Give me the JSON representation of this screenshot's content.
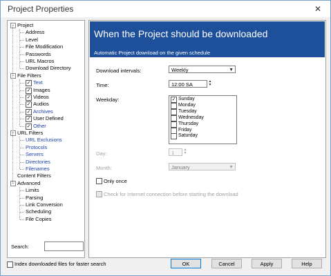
{
  "window": {
    "title": "Project Properties",
    "close_glyph": "✕"
  },
  "tree": {
    "expanded_glyph": "−",
    "check_glyph": "✓",
    "groups": [
      {
        "label": "Project",
        "children": [
          "Address",
          "Level",
          "File Modification",
          "Passwords",
          "URL Macros",
          "Download Directory"
        ]
      },
      {
        "label": "File Filters",
        "children": [
          "Text",
          "Images",
          "Videos",
          "Audios",
          "Archives",
          "User Defined",
          "Other"
        ]
      },
      {
        "label": "URL Filters",
        "children": [
          "URL Exclusions",
          "Protocols",
          "Servers",
          "Directories",
          "Filenames"
        ]
      },
      {
        "label": "Content Filters",
        "children": []
      },
      {
        "label": "Advanced",
        "children": [
          "Limits",
          "Parsing",
          "Link Conversion",
          "Scheduling",
          "File Copies"
        ]
      }
    ]
  },
  "search": {
    "label": "Search:",
    "value": ""
  },
  "panel": {
    "heading": "When the Project should be downloaded",
    "subheading": "Automatic Project download on the given schedule",
    "intervals_label": "Download intervals:",
    "intervals_value": "Weekly",
    "time_label": "Time:",
    "time_value": "12:00 SA",
    "weekday_label": "Weekday:",
    "weekdays": [
      {
        "label": "Sunday",
        "checked": true
      },
      {
        "label": "Monday",
        "checked": false
      },
      {
        "label": "Tuesday",
        "checked": false
      },
      {
        "label": "Wednesday",
        "checked": false
      },
      {
        "label": "Thursday",
        "checked": false
      },
      {
        "label": "Friday",
        "checked": false
      },
      {
        "label": "Saturday",
        "checked": false
      }
    ],
    "day_label": "Day:",
    "day_value": "1",
    "month_label": "Month:",
    "month_value": "January",
    "only_once_label": "Only once",
    "internet_check_label": "Check for Internet connection before starting the download"
  },
  "footer": {
    "index_label": "Index downloaded files for faster search",
    "ok": "OK",
    "cancel": "Cancel",
    "apply": "Apply",
    "help": "Help"
  },
  "colors": {
    "banner": "#1e4f9a",
    "link_blue": "#1a3ea8",
    "default_button_border": "#0078d7"
  }
}
